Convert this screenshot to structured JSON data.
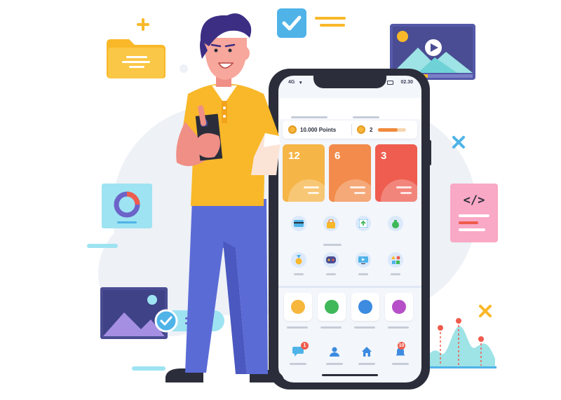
{
  "phone": {
    "status_network": "4G",
    "status_time": "02.30",
    "points_label": "10.000 Points",
    "coins_count": "2",
    "stats": [
      {
        "value": "12",
        "color": "#f6b547"
      },
      {
        "value": "6",
        "color": "#f28b4b"
      },
      {
        "value": "3",
        "color": "#ee5d4f"
      }
    ],
    "tiles": [
      {
        "color": "#f6b73c"
      },
      {
        "color": "#3fb85a"
      },
      {
        "color": "#3c8be0"
      },
      {
        "color": "#b64fc8"
      }
    ],
    "nav_badges": [
      "1",
      "10"
    ]
  },
  "decor": {
    "code_icon": "</>"
  },
  "colors": {
    "shirt": "#f9b829",
    "pants": "#5b6bd6",
    "phone_body": "#2b2e3a",
    "accent_blue": "#4fb3e8",
    "accent_purple": "#6c63c9"
  },
  "icons": [
    "folder-icon",
    "check-icon",
    "image-icon",
    "donut-chart-icon",
    "code-icon",
    "chart-icon",
    "plus-icon",
    "x-icon"
  ]
}
